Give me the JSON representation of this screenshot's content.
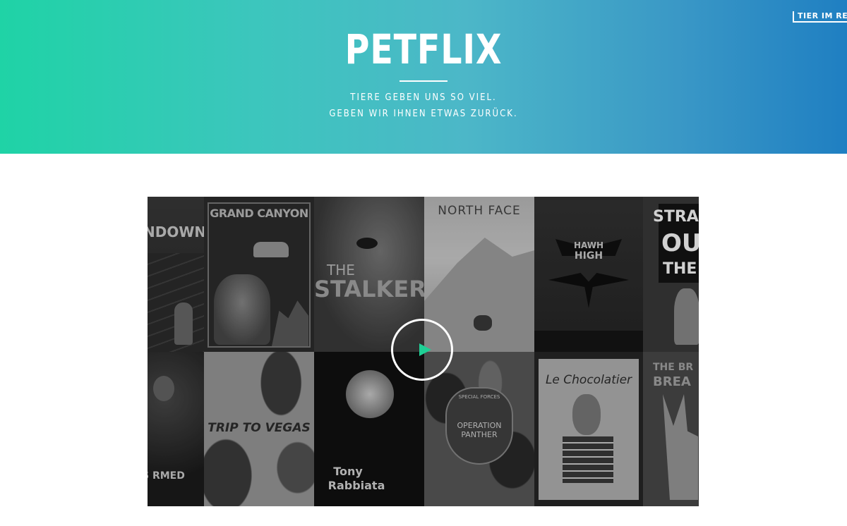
{
  "brand": {
    "logo": "PETFLIX"
  },
  "hero": {
    "tagline_line1": "TIERE GEBEN UNS SO VIEL.",
    "tagline_line2": "GEBEN WIR IHNEN ETWAS ZURÜCK."
  },
  "nav": {
    "tier_link": "TIER IM REC"
  },
  "posters": {
    "t1": "NDOWN",
    "t2": "GRAND CANYON",
    "t3a": "THE",
    "t3b": "STALKER",
    "t4": "NORTH FACE",
    "t5a": "HAWH",
    "t5b": "HIGH",
    "t6a": "STRA",
    "t6b": "OUT",
    "t6c": "THE",
    "t7": "S RMED",
    "t8": "TRIP TO VEGAS",
    "t9a": "Tony",
    "t9b": "Rabbiata",
    "t10a": "SPECIAL FORCES",
    "t10b": "OPERATION PANTHER",
    "t11": "Le Chocolatier",
    "t12a": "THE BR",
    "t12b": "BREA"
  },
  "colors": {
    "play_accent": "#1fcf95",
    "gradient_start": "#1fd3a6",
    "gradient_end": "#1f7fc2"
  },
  "icons": {
    "play": "play-icon"
  }
}
